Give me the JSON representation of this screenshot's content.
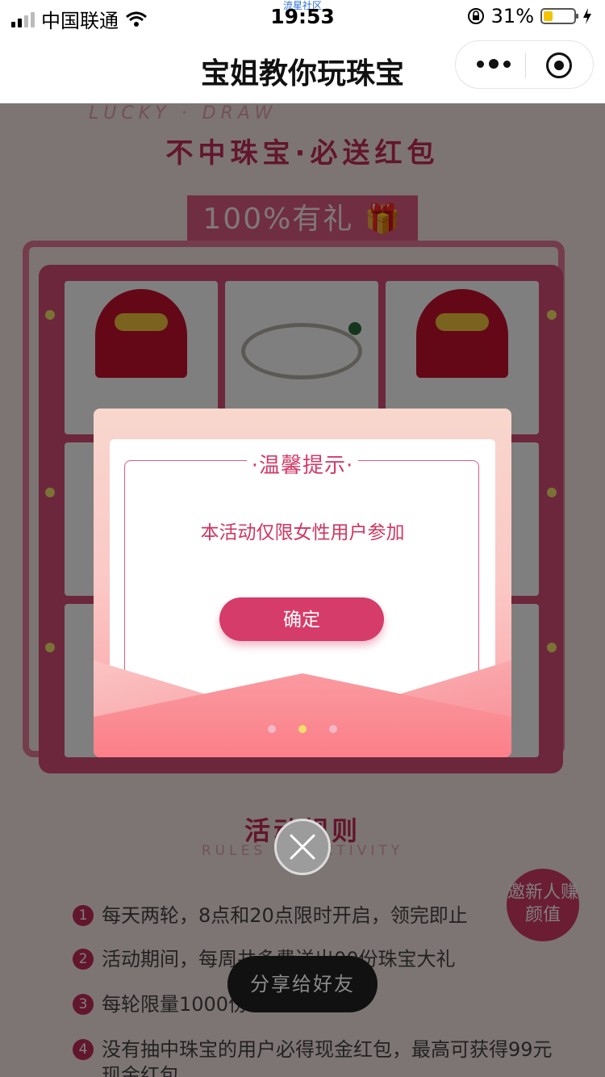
{
  "status_bar": {
    "carrier": "中国联通",
    "time": "19:53",
    "watermark": "流星社区",
    "battery": "31%",
    "battery_level": 0.31
  },
  "nav": {
    "title": "宝姐教你玩珠宝"
  },
  "page": {
    "lucky_text": "LUCKY · DRAW",
    "headline": "不中珠宝·必送红包",
    "gift_banner": "100%有礼",
    "rules_title": "活动规则",
    "rules_subtitle": "RULES OF ACTIVITY",
    "rules": [
      {
        "num": "1",
        "text": "每天两轮，8点和20点限时开启，领完即止"
      },
      {
        "num": "2",
        "text": "活动期间，每周共多费送出00份珠宝大礼"
      },
      {
        "num": "3",
        "text": "每轮限量1000份"
      },
      {
        "num": "4",
        "text": "没有抽中珠宝的用户必得现金红包，最高可获得99元现金红包"
      }
    ],
    "invite_badge": "邀新人赚颜值"
  },
  "modal": {
    "title": "·温馨提示·",
    "message": "本活动仅限女性用户参加",
    "confirm_label": "确定"
  },
  "share_button": "分享给好友",
  "colors": {
    "accent": "#d63c69",
    "modal_top": "#f8d7cd",
    "modal_bottom": "#fca0a4"
  }
}
